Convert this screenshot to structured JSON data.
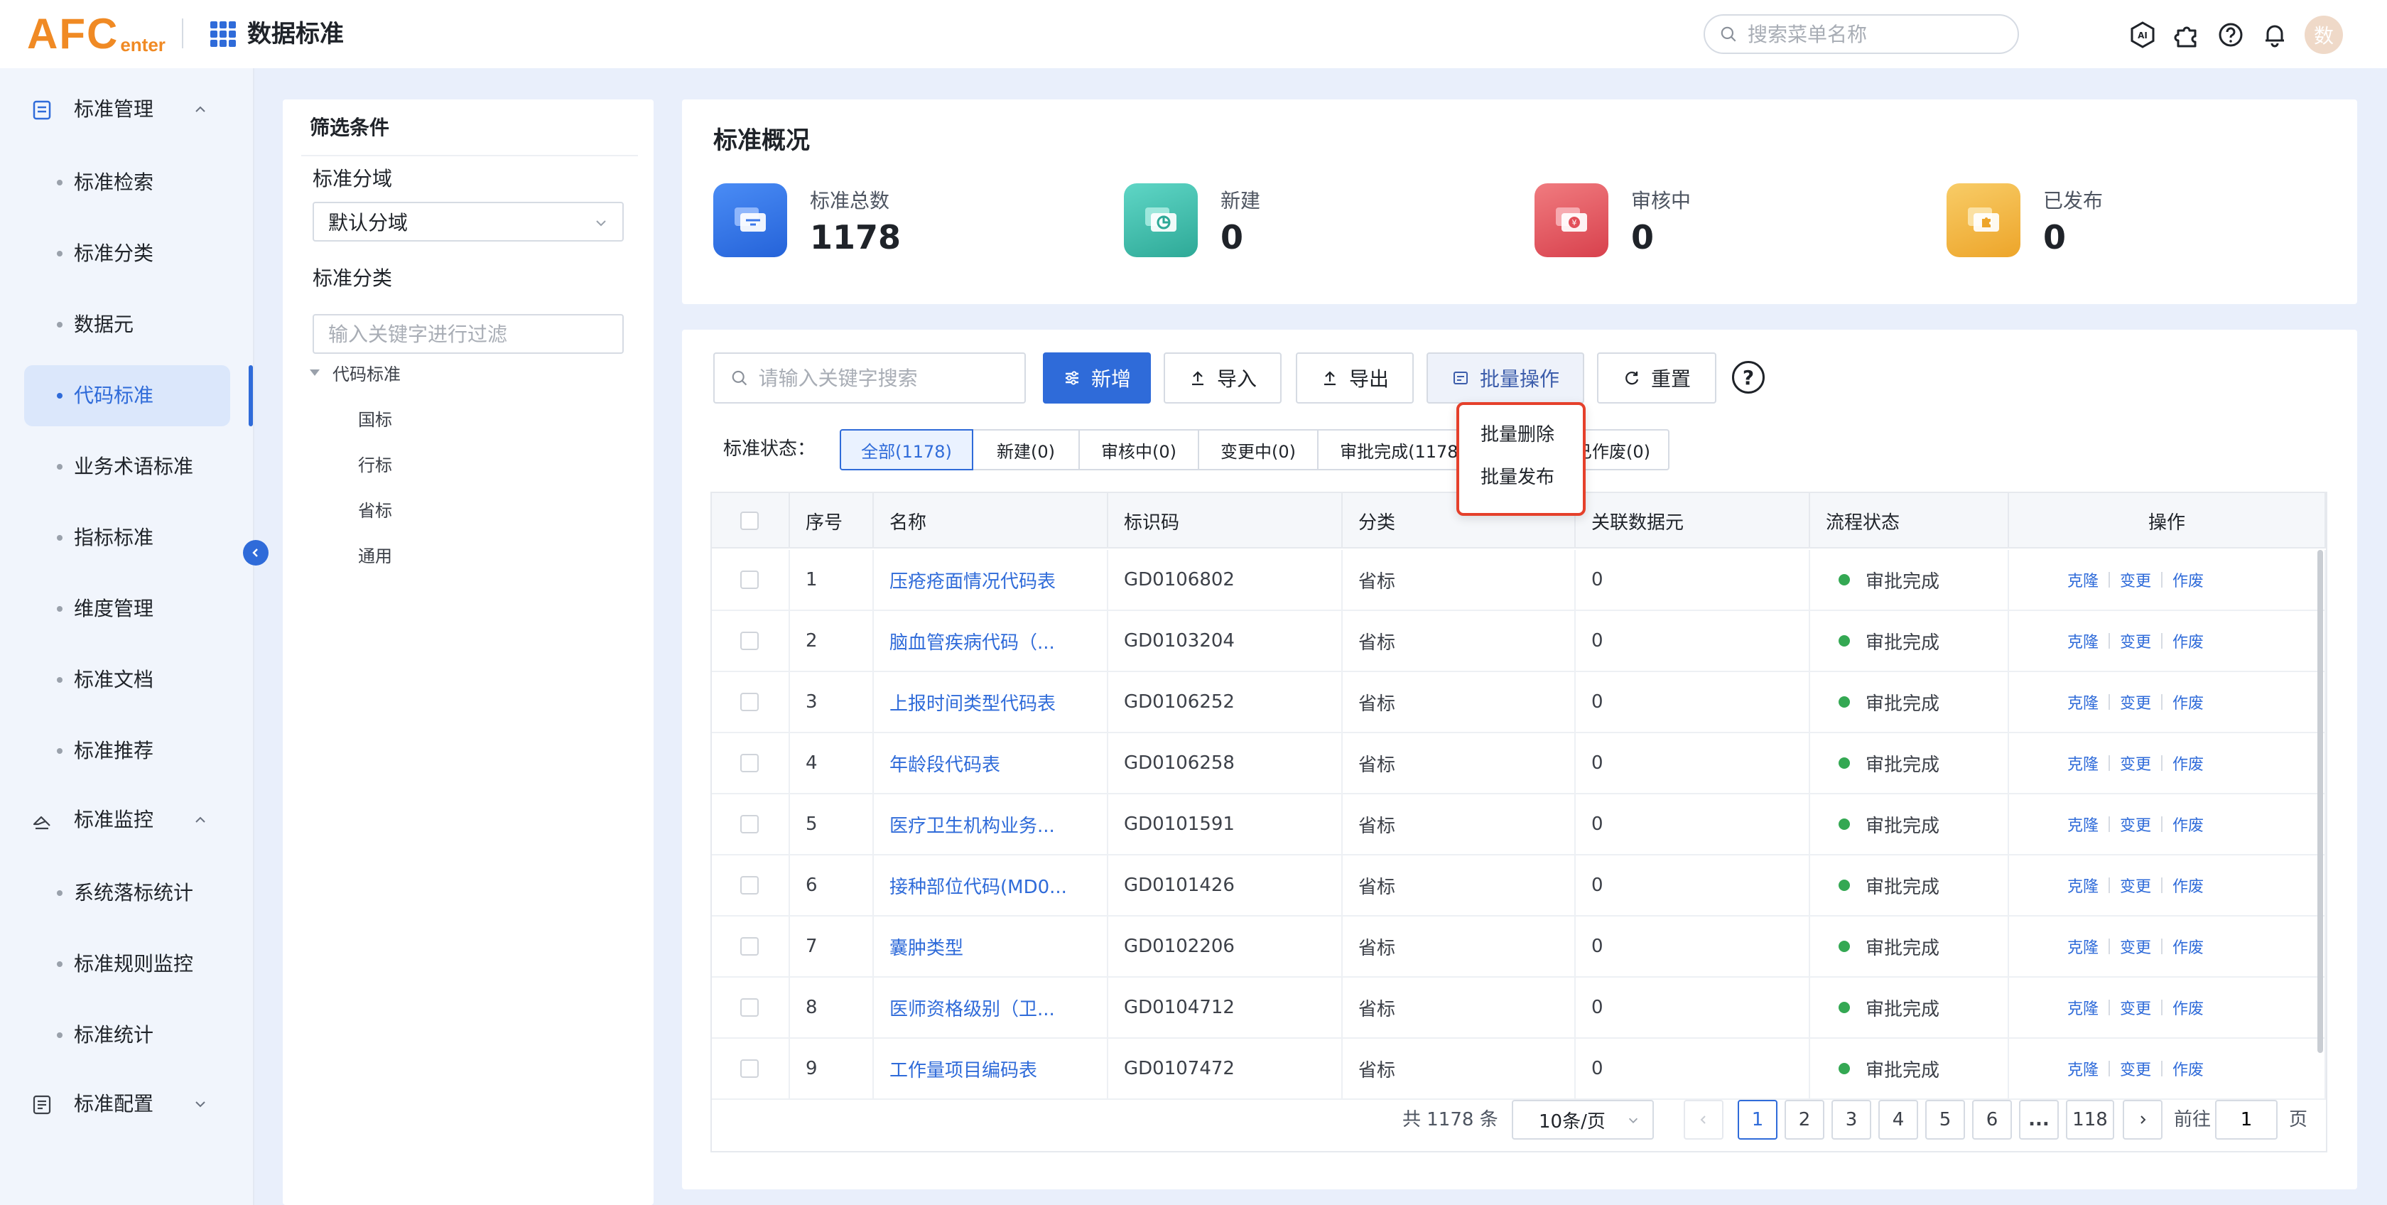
{
  "header": {
    "logo_big": "AFC",
    "logo_small": "enter",
    "app_title": "数据标准",
    "menu_search_placeholder": "搜索菜单名称",
    "avatar_text": "数",
    "icons": [
      "ai-icon",
      "puzzle-icon",
      "help-icon",
      "bell-icon"
    ]
  },
  "sidebar": {
    "groups": [
      {
        "label": "标准管理",
        "icon": "document-icon",
        "expanded": true
      },
      {
        "label": "标准监控",
        "icon": "monitor-icon",
        "expanded": true
      },
      {
        "label": "标准配置",
        "icon": "config-icon",
        "expanded": false
      }
    ],
    "items": [
      {
        "label": "标准检索"
      },
      {
        "label": "标准分类"
      },
      {
        "label": "数据元"
      },
      {
        "label": "代码标准",
        "active": true
      },
      {
        "label": "业务术语标准"
      },
      {
        "label": "指标标准"
      },
      {
        "label": "维度管理"
      },
      {
        "label": "标准文档"
      },
      {
        "label": "标准推荐"
      },
      {
        "label": "系统落标统计"
      },
      {
        "label": "标准规则监控"
      },
      {
        "label": "标准统计"
      }
    ]
  },
  "filter": {
    "title": "筛选条件",
    "domain_label": "标准分域",
    "domain_value": "默认分域",
    "category_label": "标准分类",
    "category_placeholder": "输入关键字进行过滤",
    "tree": {
      "root": "代码标准",
      "children": [
        "国标",
        "行标",
        "省标",
        "通用"
      ]
    }
  },
  "overview": {
    "title": "标准概况",
    "stats": [
      {
        "label": "标准总数",
        "value": "1178",
        "color": "#2f6bd9"
      },
      {
        "label": "新建",
        "value": "0",
        "color": "#3dbfae"
      },
      {
        "label": "审核中",
        "value": "0",
        "color": "#e2505a"
      },
      {
        "label": "已发布",
        "value": "0",
        "color": "#f3b23a"
      }
    ]
  },
  "toolbar": {
    "search_placeholder": "请输入关键字搜索",
    "add_label": "新增",
    "import_label": "导入",
    "export_label": "导出",
    "batch_label": "批量操作",
    "reset_label": "重置",
    "help_label": "?"
  },
  "batch_menu": {
    "items": [
      "批量删除",
      "批量发布"
    ]
  },
  "status_filter": {
    "label": "标准状态：",
    "tabs": [
      {
        "label": "全部(1178)",
        "active": true
      },
      {
        "label": "新建(0)"
      },
      {
        "label": "审核中(0)"
      },
      {
        "label": "变更中(0)"
      },
      {
        "label": "审批完成(1178)"
      },
      {
        "label": ")"
      },
      {
        "label": "已作废(0)"
      }
    ]
  },
  "table": {
    "columns": [
      "序号",
      "名称",
      "标识码",
      "分类",
      "关联数据元",
      "流程状态",
      "操作"
    ],
    "rows": [
      {
        "no": "1",
        "name": "压疮疮面情况代码表",
        "code": "GD0106802",
        "category": "省标",
        "related": "0",
        "status": "审批完成"
      },
      {
        "no": "2",
        "name": "脑血管疾病代码（...",
        "code": "GD0103204",
        "category": "省标",
        "related": "0",
        "status": "审批完成"
      },
      {
        "no": "3",
        "name": "上报时间类型代码表",
        "code": "GD0106252",
        "category": "省标",
        "related": "0",
        "status": "审批完成"
      },
      {
        "no": "4",
        "name": "年龄段代码表",
        "code": "GD0106258",
        "category": "省标",
        "related": "0",
        "status": "审批完成"
      },
      {
        "no": "5",
        "name": "医疗卫生机构业务...",
        "code": "GD0101591",
        "category": "省标",
        "related": "0",
        "status": "审批完成"
      },
      {
        "no": "6",
        "name": "接种部位代码(MD0...",
        "code": "GD0101426",
        "category": "省标",
        "related": "0",
        "status": "审批完成"
      },
      {
        "no": "7",
        "name": "囊肿类型",
        "code": "GD0102206",
        "category": "省标",
        "related": "0",
        "status": "审批完成"
      },
      {
        "no": "8",
        "name": "医师资格级别（卫...",
        "code": "GD0104712",
        "category": "省标",
        "related": "0",
        "status": "审批完成"
      },
      {
        "no": "9",
        "name": "工作量项目编码表",
        "code": "GD0107472",
        "category": "省标",
        "related": "0",
        "status": "审批完成"
      }
    ],
    "actions": [
      "克隆",
      "变更",
      "作废"
    ],
    "status_color": "#34a853"
  },
  "pagination": {
    "total": "共 1178 条",
    "page_size": "10条/页",
    "pages": [
      "1",
      "2",
      "3",
      "4",
      "5",
      "6",
      "...",
      "118"
    ],
    "current": "1",
    "goto_label": "前往",
    "goto_value": "1",
    "page_label": "页"
  },
  "colors": {
    "accent": "#2f6bd9",
    "logo": "#f08a24",
    "highlight": "#e5402b"
  }
}
